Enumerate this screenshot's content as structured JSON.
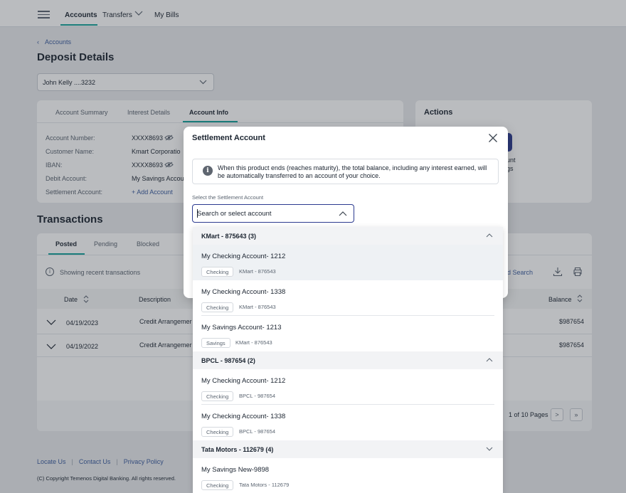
{
  "nav": {
    "items": [
      "Accounts",
      "Transfers",
      "My Bills"
    ]
  },
  "breadcrumb": "Accounts",
  "page_title": "Deposit Details",
  "account_select": "John Kelly ....3232",
  "info_tabs": [
    "Account Summary",
    "Interest Details",
    "Account Info"
  ],
  "account_info": {
    "labels": [
      "Account Number:",
      "Customer Name:",
      "IBAN:",
      "Debit Account:",
      "Settlement Account:"
    ],
    "values": [
      "XXXX8693",
      "Kmart Corporatio",
      "XXXX8693",
      "My Savings Accou",
      "+ Add Account"
    ]
  },
  "actions": {
    "title": "Actions",
    "partial_text": [
      "unt",
      "gs"
    ]
  },
  "transactions": {
    "title": "Transactions",
    "tabs": [
      "Posted",
      "Pending",
      "Blocked"
    ],
    "info": "Showing recent transactions",
    "advanced_search": "ed Search",
    "headers": {
      "date": "Date",
      "description": "Description",
      "balance": "Balance"
    },
    "rows": [
      {
        "date": "04/19/2023",
        "description": "Credit Arrangemer",
        "balance": "$987654"
      },
      {
        "date": "04/19/2022",
        "description": "Credit Arrangemer",
        "balance": "$987654"
      }
    ],
    "pagination": "1 of 10 Pages",
    "next": ">",
    "last": "»"
  },
  "footer": {
    "links": [
      "Locate Us",
      "Contact Us",
      "Privacy Policy"
    ],
    "copyright": "(C) Copyright Temenos Digital Banking. All rights reserved."
  },
  "modal": {
    "title": "Settlement Account",
    "notice": "When this product ends (reaches maturity), the total balance, including any interest earned, will be automatically transferred to an account of your choice.",
    "field_label": "Select the Settlement Account",
    "placeholder": "Search or select account"
  },
  "dropdown": {
    "groups": [
      {
        "name": "KMart - 875643 (3)",
        "options": [
          {
            "name": "My Checking Account- 1212",
            "type": "Checking",
            "customer": "KMart - 876543"
          },
          {
            "name": "My Checking Account- 1338",
            "type": "Checking",
            "customer": "KMart - 876543"
          },
          {
            "name": "My Savings Account- 1213",
            "type": "Savings",
            "customer": "KMart - 876543"
          }
        ]
      },
      {
        "name": "BPCL - 987654 (2)",
        "options": [
          {
            "name": "My Checking Account- 1212",
            "type": "Checking",
            "customer": "BPCL - 987654"
          },
          {
            "name": "My Checking Account- 1338",
            "type": "Checking",
            "customer": "BPCL - 987654"
          }
        ]
      },
      {
        "name": "Tata Motors - 112679 (4)",
        "options": [
          {
            "name": "My Savings New-9898",
            "type": "Checking",
            "customer": "Tata Motors - 112679"
          }
        ]
      }
    ]
  }
}
